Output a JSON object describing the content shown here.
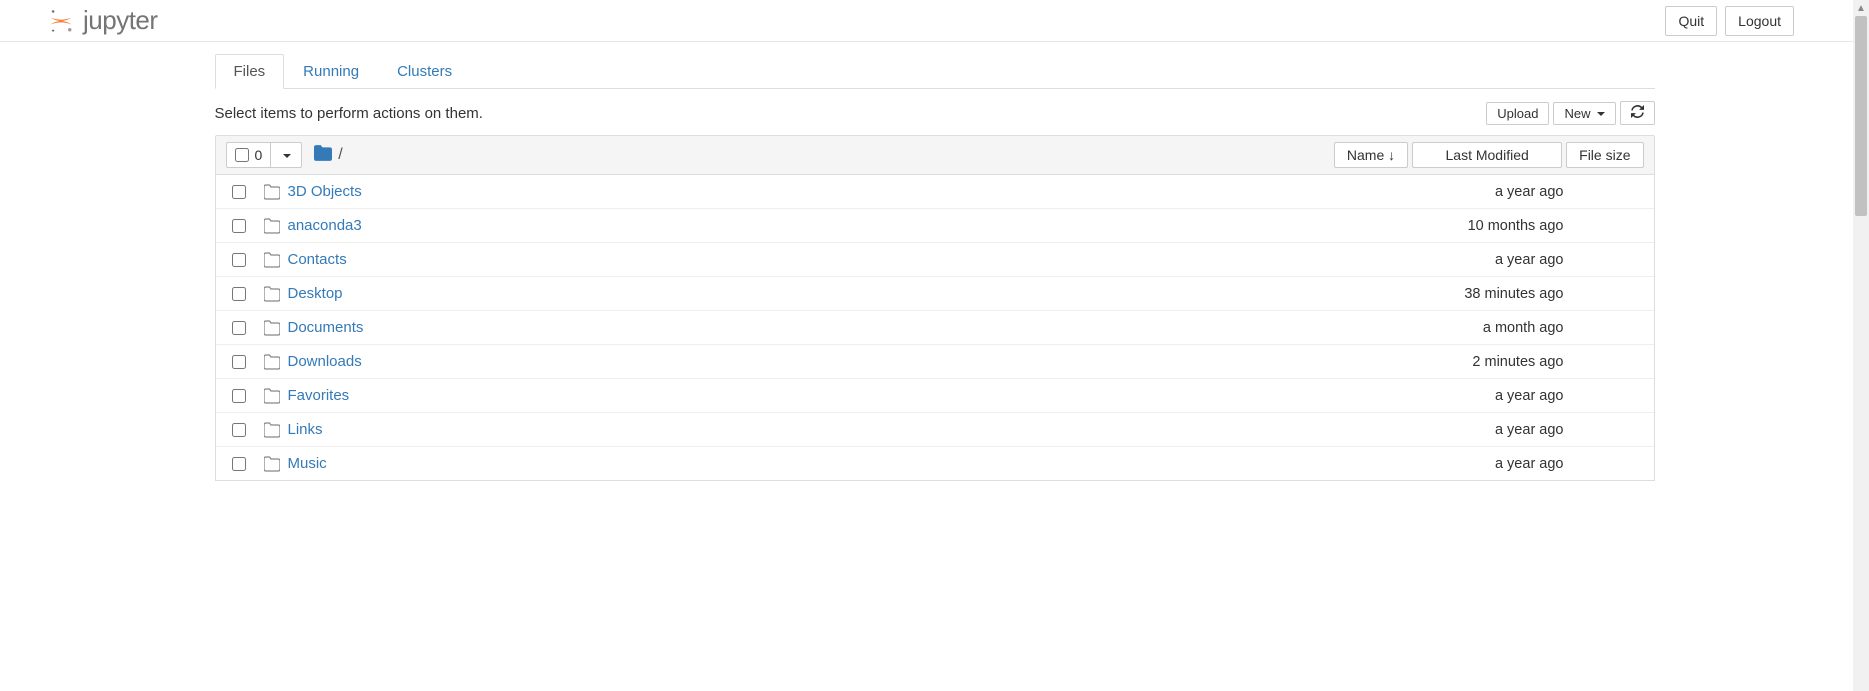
{
  "header": {
    "logo_text": "jupyter",
    "quit": "Quit",
    "logout": "Logout"
  },
  "tabs": {
    "files": "Files",
    "running": "Running",
    "clusters": "Clusters"
  },
  "toolbar": {
    "instruction": "Select items to perform actions on them.",
    "upload": "Upload",
    "new": "New"
  },
  "list_header": {
    "selected_count": "0",
    "breadcrumb_sep": "/",
    "name_col": "Name",
    "modified_col": "Last Modified",
    "size_col": "File size"
  },
  "items": [
    {
      "name": "3D Objects",
      "modified": "a year ago",
      "size": ""
    },
    {
      "name": "anaconda3",
      "modified": "10 months ago",
      "size": ""
    },
    {
      "name": "Contacts",
      "modified": "a year ago",
      "size": ""
    },
    {
      "name": "Desktop",
      "modified": "38 minutes ago",
      "size": ""
    },
    {
      "name": "Documents",
      "modified": "a month ago",
      "size": ""
    },
    {
      "name": "Downloads",
      "modified": "2 minutes ago",
      "size": ""
    },
    {
      "name": "Favorites",
      "modified": "a year ago",
      "size": ""
    },
    {
      "name": "Links",
      "modified": "a year ago",
      "size": ""
    },
    {
      "name": "Music",
      "modified": "a year ago",
      "size": ""
    }
  ]
}
